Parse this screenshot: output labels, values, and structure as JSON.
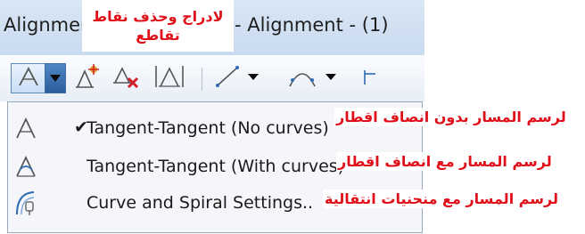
{
  "window": {
    "title_left": "Alignment",
    "title_right": "- Alignment - (1)"
  },
  "annotations": {
    "header_line1": "لادراج وحذف نقاط",
    "header_line2": "تقاطع",
    "item1": "لرسم المسار بدون انصاف اقطار",
    "item2": "لرسم المسار مع انصاف اقطار",
    "item3": "لرسم المسار مع منحنيات انتقالية"
  },
  "toolbar": {
    "buttons": [
      {
        "name": "tangent-tangent-split-button",
        "icon": "tangent-tangent-icon"
      },
      {
        "name": "split-dropdown-arrow",
        "icon": "chevron-down-icon"
      },
      {
        "name": "insert-pi-button",
        "icon": "insert-pi-icon"
      },
      {
        "name": "delete-pi-button",
        "icon": "delete-pi-icon"
      },
      {
        "name": "break-apart-pi-button",
        "icon": "pi-edit-icon"
      },
      {
        "name": "line-tools-button",
        "icon": "line-icon"
      },
      {
        "name": "curve-tools-button",
        "icon": "curve-icon"
      }
    ]
  },
  "menu": {
    "items": [
      {
        "label": "Tangent-Tangent (No curves)",
        "checked": true,
        "icon": "tangent-no-curves-icon"
      },
      {
        "label": "Tangent-Tangent (With curves)",
        "checked": false,
        "icon": "tangent-with-curves-icon"
      },
      {
        "label": "Curve and Spiral Settings..",
        "checked": false,
        "icon": "curve-spiral-settings-icon"
      }
    ],
    "check_glyph": "✔"
  },
  "colors": {
    "annotation_red": "#e0101a",
    "icon_blue": "#2e6db4",
    "accent_red": "#d0202a",
    "accent_gold": "#e0a020"
  }
}
